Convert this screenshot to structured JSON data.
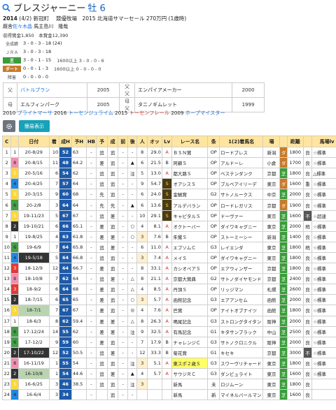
{
  "header": {
    "name": "ブレスジャーニー",
    "sex_age": "牡 6"
  },
  "profile": {
    "line1_birth": "2014",
    "line1_birthdate": "(4/2)",
    "line1_rest": "新冠町　 競優牧場　2015 北海道サマーセール 270万円 (1歳時)",
    "trainer_label": "厩舎",
    "trainer": "佐々木晶",
    "owner_label": "馬主",
    "owner": "島川　隆哉",
    "prize": "収得賞金1,850　本賞金12,390"
  },
  "stats": {
    "rows": [
      {
        "label": "全成績",
        "value": "3 - 0 - 3 - 18 (24)",
        "extra": ""
      },
      {
        "label": "ＪＲＡ",
        "value": "3 - 0 - 3 - 18",
        "extra": ""
      },
      {
        "label": "芝",
        "value": "3 - 0 - 1 - 15",
        "extra": "1600以上  3 - 0 - 0 - 6"
      },
      {
        "label": "ダート",
        "value": "0 - 0 - 1 - 3",
        "extra": "1600以上  0 - 0 - 0 - 0"
      },
      {
        "label": "障害",
        "value": "0 - 0 - 0 - 0",
        "extra": ""
      }
    ]
  },
  "pedigree": [
    {
      "rel": "父",
      "name": "バトルプラン",
      "year": "2005",
      "rel2": "父父",
      "name2": "エンパイアメーカー",
      "year2": "2000"
    },
    {
      "rel": "母",
      "name": "エルフィンパーク",
      "year": "2005",
      "rel2": "母父",
      "name2": "タニノギムレット",
      "year2": "1999"
    }
  ],
  "siblings": {
    "s1_year": "2010",
    "s1_name": "ブライトマーサ",
    "s2_year": "2016",
    "s2_name": "トーセンジュライム",
    "s3_year": "2015",
    "s3_name": "トーセンフレール",
    "s4_year": "2009",
    "s4_name": "ホープマイスター"
  },
  "controls": {
    "simple_label": "簡易表示"
  },
  "table": {
    "headers": [
      "C",
      "",
      "日付",
      "着",
      "成H",
      "予H",
      "HB",
      "予",
      "成",
      "前",
      "後",
      "人",
      "オッ",
      "Lv",
      "レース名",
      "条",
      "1(2)着馬名",
      "場",
      "",
      "距離",
      "",
      "馬場lv"
    ],
    "rows": [
      {
        "n": "1",
        "w": "1",
        "d": "20-8/29",
        "f": "10",
        "h": "52",
        "p": "63",
        "hb": "-",
        "y": "追",
        "s": "追",
        "ma": "-",
        "ba": "-",
        "pop": "8",
        "odds": "29.0",
        "lv": "A",
        "race": "ＢＳＮ賞",
        "cls": "OP",
        "win": "ロードブレス",
        "pl": "新潟",
        "sf": "ダ",
        "dist": "1800",
        "c": "良",
        "lvb": "☆標準"
      },
      {
        "n": "2",
        "w": "8",
        "d": "20-8/15",
        "f": "11",
        "h": "48",
        "p": "64.2",
        "hb": "-",
        "y": "差",
        "s": "追",
        "ma": "-",
        "ba": "▲",
        "pop": "6",
        "odds": "21.5",
        "lv": "B",
        "race": "阿蘇Ｓ",
        "cls": "OP",
        "win": "アルドーレ",
        "pl": "小倉",
        "sf": "ダ",
        "dist": "1700",
        "c": "良",
        "lvb": "☆標準"
      },
      {
        "n": "3",
        "w": "5",
        "d": "20-5/16",
        "f": "6",
        "h": "54",
        "p": "62",
        "hb": "-",
        "y": "追",
        "s": "追",
        "ma": "-",
        "ba": "注",
        "pop": "5",
        "odds": "13.0",
        "lv": "A",
        "race": "都大路Ｓ",
        "cls": "OP",
        "win": "ベステンダンク",
        "pl": "京都",
        "sf": "芝",
        "dist": "1800",
        "c": "良",
        "lvb": "△標準"
      },
      {
        "n": "4",
        "w": "4",
        "d": "20-4/25",
        "f": "7",
        "h": "57",
        "p": "64",
        "hb": "-",
        "y": "追",
        "s": "追",
        "ma": "-",
        "ba": "-",
        "pop": "9",
        "odds": "54.7",
        "lv": "S",
        "race": "オアシスＳ",
        "cls": "OP",
        "win": "ブルベアイリーデ",
        "pl": "東京",
        "sf": "ダ",
        "dist": "1600",
        "c": "重",
        "lvb": "☆標準"
      },
      {
        "n": "5",
        "w": "5",
        "d": "20-3/15",
        "f": "9",
        "h": "60",
        "p": "68",
        "hb": "-",
        "y": "先",
        "s": "追",
        "ma": "-",
        "ba": "-",
        "pop": "6",
        "odds": "24.0",
        "lv": "S",
        "race": "金鯱賞",
        "cls": "G2",
        "win": "サトノルークス",
        "pl": "中京",
        "sf": "芝",
        "dist": "2000",
        "c": "良",
        "lvb": "☆標準"
      },
      {
        "n": "6",
        "w": "6",
        "d": "20-2/8",
        "f": "3",
        "h": "64",
        "p": "64",
        "hb": "-",
        "y": "先",
        "s": "先",
        "ma": "-",
        "ba": "▲",
        "pop": "6",
        "odds": "13.6",
        "lv": "S",
        "race": "アルデバラン",
        "cls": "OP",
        "win": "ロードレガリス",
        "pl": "京都",
        "sf": "ダ",
        "dist": "1900",
        "c": "良",
        "lvb": "☆標準"
      },
      {
        "n": "7",
        "w": "5",
        "d": "19-11/23",
        "f": "5",
        "h": "67",
        "p": "67",
        "hb": "-",
        "y": "追",
        "s": "差",
        "ma": "-",
        "ba": "-",
        "pop": "10",
        "odds": "29.1",
        "lv": "S",
        "race": "キャピタルＳ",
        "cls": "OP",
        "win": "ドーヴァー",
        "pl": "東京",
        "sf": "芝",
        "dist": "1600",
        "c": "不",
        "lvb": "☆超速"
      },
      {
        "n": "8",
        "w": "2",
        "d": "19-10/21",
        "f": "6",
        "h": "66",
        "p": "65.1",
        "hb": "-",
        "y": "差",
        "s": "追",
        "ma": "-",
        "ba": "○",
        "pop": "4",
        "odds": "8.1",
        "lv": "A",
        "race": "オクトーバー",
        "cls": "OP",
        "win": "ダイワキャグニー",
        "pl": "東京",
        "sf": "芝",
        "dist": "2000",
        "c": "稍",
        "lvb": "☆標準"
      },
      {
        "n": "9",
        "w": "1",
        "d": "19-8/25",
        "f": "4",
        "h": "63",
        "p": "61.8",
        "hb": "-",
        "y": "差",
        "s": "差",
        "ma": "-",
        "ba": "○",
        "pop": "3",
        "odds": "7.6",
        "lv": "B",
        "race": "朱鷺Ｓ",
        "cls": "OP",
        "win": "ストーミーシー",
        "pl": "新潟",
        "sf": "芝",
        "dist": "1400",
        "c": "良",
        "lvb": "☆標準"
      },
      {
        "n": "10",
        "w": "6",
        "d": "19-6/9",
        "f": "7",
        "h": "64",
        "p": "65.8",
        "hb": "-",
        "y": "追",
        "s": "差",
        "ma": "-",
        "ba": "-",
        "pop": "6",
        "odds": "11.0",
        "lv": "A",
        "race": "エプソムＣ",
        "cls": "G3",
        "win": "レイエンダ",
        "pl": "東京",
        "sf": "芝",
        "dist": "1800",
        "c": "稍",
        "lvb": "☆標準"
      },
      {
        "n": "11",
        "w": "4",
        "d": "19-5/18",
        "f": "5",
        "h": "64",
        "p": "66.8",
        "hb": "-",
        "y": "追",
        "s": "追",
        "ma": "-",
        "ba": "-",
        "pop": "3",
        "odds": "7.4",
        "lv": "A",
        "race": "メイＳ",
        "cls": "OP",
        "win": "ダイワキャグニー",
        "pl": "東京",
        "sf": "芝",
        "dist": "1800",
        "c": "良",
        "lvb": "☆標準"
      },
      {
        "n": "12",
        "w": "3",
        "d": "18-12/9",
        "f": "12",
        "h": "64",
        "p": "66.7",
        "hb": "-",
        "y": "差",
        "s": "追",
        "ma": "-",
        "ba": "-",
        "pop": "8",
        "odds": "33.1",
        "lv": "A",
        "race": "カシオペアＳ",
        "cls": "OP",
        "win": "エアウィンザー",
        "pl": "京都",
        "sf": "芝",
        "dist": "1800",
        "c": "良",
        "lvb": "☆標準"
      },
      {
        "n": "13",
        "w": "8",
        "d": "18-10/8",
        "f": "7",
        "h": "62",
        "p": "64",
        "hb": "-",
        "y": "追",
        "s": "差",
        "ma": "-",
        "ba": "△",
        "pop": "8",
        "odds": "21.1",
        "lv": "A",
        "race": "京都大賞典",
        "cls": "G2",
        "win": "サトノダイヤモンド",
        "pl": "京都",
        "sf": "芝",
        "dist": "2400",
        "c": "良",
        "lvb": "☆標準"
      },
      {
        "n": "14",
        "w": "3",
        "d": "18-9/2",
        "f": "6",
        "h": "64",
        "p": "68",
        "hb": "-",
        "y": "差",
        "s": "追",
        "ma": "-",
        "ba": "△",
        "pop": "4",
        "odds": "8.5",
        "lv": "A",
        "race": "丹頂Ｓ",
        "cls": "OP",
        "win": "リッジマン",
        "pl": "札幌",
        "sf": "芝",
        "dist": "2600",
        "c": "良",
        "lvb": "☆標準"
      },
      {
        "n": "15",
        "w": "2",
        "d": "18-7/15",
        "f": "6",
        "h": "65",
        "p": "65",
        "hb": "-",
        "y": "差",
        "s": "追",
        "ma": "-",
        "ba": "○",
        "pop": "3",
        "odds": "5.7",
        "lv": "A",
        "race": "函館記念",
        "cls": "G3",
        "win": "エアアンセム",
        "pl": "函館",
        "sf": "芝",
        "dist": "2000",
        "c": "良",
        "lvb": "☆標準"
      },
      {
        "n": "16",
        "w": "5",
        "d": "18-7/1",
        "f": "7",
        "h": "67",
        "p": "67",
        "hb": "-",
        "y": "差",
        "s": "追",
        "ma": "-",
        "ba": "◎",
        "pop": "4",
        "odds": "7.6",
        "lv": "A",
        "race": "巴賞",
        "cls": "OP",
        "win": "ナイトオブナイツ",
        "pl": "函館",
        "sf": "芝",
        "dist": "1800",
        "c": "良",
        "lvb": "☆標準"
      },
      {
        "n": "17",
        "w": "1",
        "d": "18-6/3",
        "f": "8",
        "h": "62",
        "p": "59.4",
        "hb": "-",
        "y": "差",
        "s": "差",
        "ma": "-",
        "ba": "△",
        "pop": "8",
        "odds": "26.3",
        "lv": "A",
        "race": "鳴尾記念",
        "cls": "G3",
        "win": "ストロングタイタン",
        "pl": "阪神",
        "sf": "芝",
        "dist": "2000",
        "c": "良",
        "lvb": "☆標準"
      },
      {
        "n": "18",
        "w": "6",
        "d": "17-12/24",
        "f": "14",
        "h": "55",
        "p": "62",
        "hb": "-",
        "y": "差",
        "s": "差",
        "ma": "-",
        "ba": "注",
        "pop": "9",
        "odds": "32.5",
        "lv": "A",
        "race": "有馬記念",
        "cls": "G1",
        "win": "キタサンブラック",
        "pl": "中山",
        "sf": "芝",
        "dist": "2500",
        "c": "良",
        "lvb": "☆標準"
      },
      {
        "n": "19",
        "w": "6",
        "d": "17-12/2",
        "f": "9",
        "h": "59",
        "p": "60",
        "hb": "-",
        "y": "差",
        "s": "追",
        "ma": "-",
        "ba": "-",
        "pop": "7",
        "odds": "17.9",
        "lv": "B",
        "race": "チャレンジＣ",
        "cls": "G3",
        "win": "サトノクロニクル",
        "pl": "阪神",
        "sf": "芝",
        "dist": "2000",
        "c": "良",
        "lvb": "☆標準"
      },
      {
        "n": "20",
        "w": "2",
        "d": "17-10/22",
        "f": "12",
        "h": "52",
        "p": "50.5",
        "hb": "-",
        "y": "追",
        "s": "差",
        "ma": "-",
        "ba": "-",
        "pop": "12",
        "odds": "33.3",
        "lv": "B",
        "race": "菊花賞",
        "cls": "G1",
        "win": "キセキ",
        "pl": "京都",
        "sf": "芝",
        "dist": "3000",
        "c": "不",
        "lvb": "☆標準"
      },
      {
        "n": "21",
        "w": "8",
        "d": "16-11/19",
        "f": "1",
        "h": "55",
        "p": "54",
        "hb": "-",
        "y": "追",
        "s": "追",
        "ma": "-",
        "ba": "注",
        "pop": "3",
        "odds": "5.1",
        "lv": "A",
        "race": "東スポ２歳Ｓ",
        "cls": "G3",
        "win": "スワーヴリチャード",
        "pl": "東京",
        "sf": "芝",
        "dist": "1800",
        "c": "良",
        "lvb": "☆標準"
      },
      {
        "n": "22",
        "w": "2",
        "d": "16-10/8",
        "f": "1",
        "h": "54",
        "p": "44.6",
        "hb": "-",
        "y": "追",
        "s": "差",
        "ma": "-",
        "ba": "▲",
        "pop": "4",
        "odds": "5.7",
        "lv": "A",
        "race": "サウジＲＣ",
        "cls": "G3",
        "win": "ダンビュライト",
        "pl": "東京",
        "sf": "芝",
        "dist": "1600",
        "c": "良",
        "lvb": "☆標準"
      },
      {
        "n": "23",
        "w": "5",
        "d": "16-6/25",
        "f": "3",
        "h": "46",
        "p": "38.5",
        "hb": "-",
        "y": "追",
        "s": "追",
        "ma": "-",
        "ba": "注",
        "pop": "3",
        "odds": "",
        "lv": "",
        "race": "新馬",
        "cls": "未",
        "win": "ロジムーン",
        "pl": "東京",
        "sf": "芝",
        "dist": "1800",
        "c": "良",
        "lvb": ""
      },
      {
        "n": "24",
        "w": "4",
        "d": "16-6/4",
        "f": "3",
        "h": "34",
        "p": "",
        "hb": "-",
        "y": "",
        "s": "追",
        "ma": "-",
        "ba": "-",
        "pop": "",
        "odds": "",
        "lv": "",
        "race": "新馬",
        "cls": "新",
        "win": "マイネルバールマン",
        "pl": "東京",
        "sf": "芝",
        "dist": "1600",
        "c": "良",
        "lvb": ""
      }
    ]
  },
  "colors": {
    "frame": [
      "#ffffff",
      "#333333",
      "#e53935",
      "#1e88e5",
      "#fdd835",
      "#43a047",
      "#fb8c00",
      "#f48fb1"
    ],
    "turf": "#3a9d3a",
    "dirt": "#c87a2a",
    "header_bg": "#ffe59e",
    "link": "#1a73e8"
  }
}
